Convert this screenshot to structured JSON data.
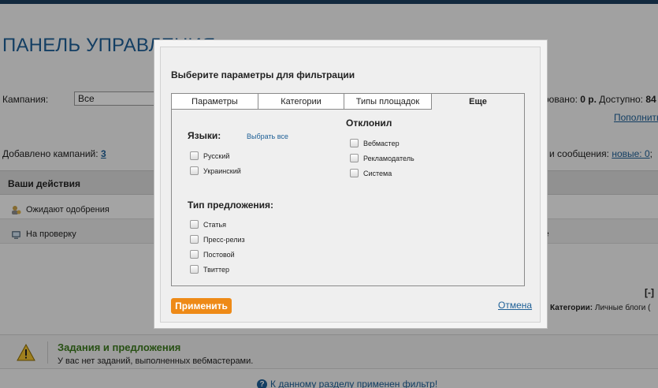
{
  "background": {
    "page_title": "ПАНЕЛЬ УПРАВЛЕНИЯ",
    "campaign_label": "Кампания:",
    "campaign_value": "Все",
    "balance_prefix": "ровано:",
    "balance_reserved": "0 р.",
    "balance_available_label": "Доступно:",
    "balance_available": "84",
    "topup_link": "Пополнить",
    "added_label": "Добавлено кампаний:",
    "added_count": "3",
    "messages_label": "и сообщения:",
    "messages_link": "новые: 0",
    "messages_suffix": ";",
    "actions_header": "Ваши действия",
    "action_rows": [
      "Ожидают одобрения",
      "На проверку"
    ],
    "right_fragment": "е",
    "collapse": "[-]",
    "categories_label": "Категории:",
    "categories_value": "Личные блоги (",
    "notice_title": "Задания и предложения",
    "notice_text": "У вас нет заданий, выполненных вебмастерами.",
    "filter_note": "К данному разделу применен фильтр!"
  },
  "modal": {
    "title": "Выберите параметры для фильтрации",
    "tabs": [
      {
        "label": "Параметры",
        "active": false
      },
      {
        "label": "Категории",
        "active": false
      },
      {
        "label": "Типы площадок",
        "active": false
      },
      {
        "label": "Еще",
        "active": true
      }
    ],
    "languages": {
      "title": "Языки:",
      "select_all": "Выбрать все",
      "options": [
        "Русский",
        "Украинский"
      ]
    },
    "offer_type": {
      "title": "Тип предложения:",
      "options": [
        "Статья",
        "Пресс-релиз",
        "Постовой",
        "Твиттер"
      ]
    },
    "declined": {
      "title": "Отклонил",
      "options": [
        "Вебмастер",
        "Рекламодатель",
        "Система"
      ]
    },
    "apply_button": "Применить",
    "cancel_link": "Отмена"
  },
  "colors": {
    "accent": "#ee8a17",
    "link": "#1d5f96",
    "notice_title": "#3c7a1e"
  }
}
